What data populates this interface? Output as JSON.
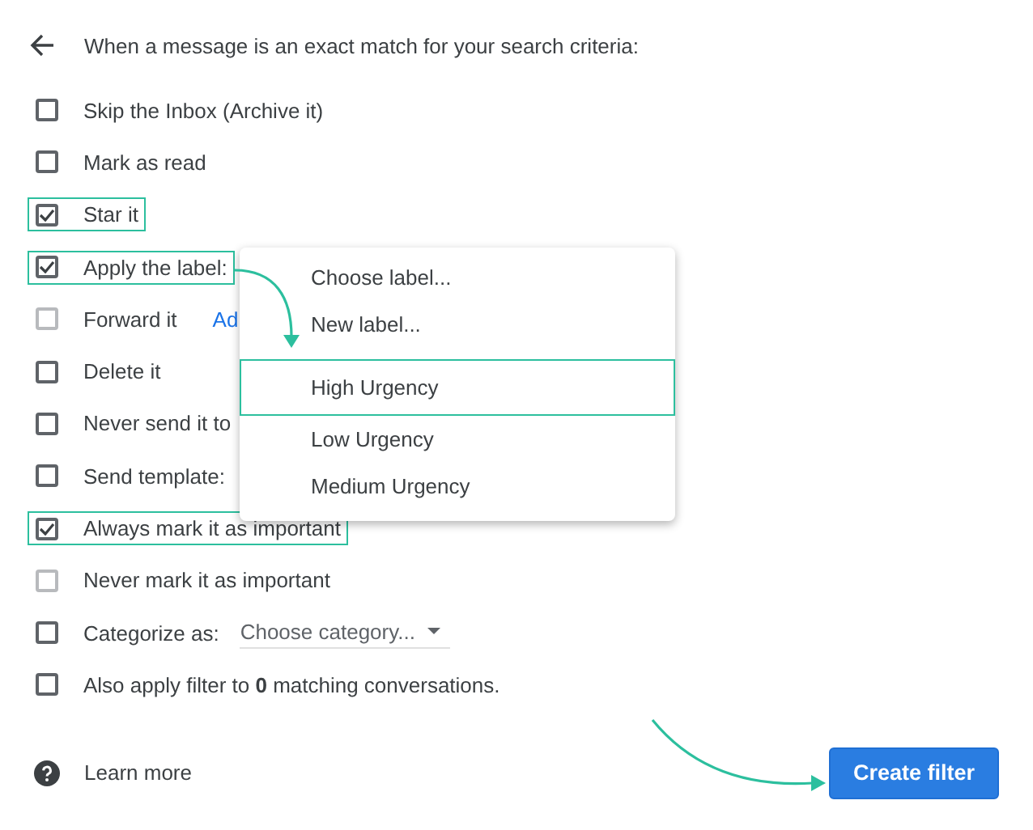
{
  "header": {
    "text": "When a message is an exact match for your search criteria:"
  },
  "actions": [
    {
      "kind": "plain",
      "label": "Skip the Inbox (Archive it)",
      "checked": false,
      "disabled": false,
      "highlighted": false
    },
    {
      "kind": "plain",
      "label": "Mark as read",
      "checked": false,
      "disabled": false,
      "highlighted": false
    },
    {
      "kind": "plain",
      "label": "Star it",
      "checked": true,
      "disabled": false,
      "highlighted": true
    },
    {
      "kind": "plain",
      "label": "Apply the label:",
      "checked": true,
      "disabled": false,
      "highlighted": true
    },
    {
      "kind": "link",
      "label": "Forward it",
      "link": "Ad",
      "checked": false,
      "disabled": true,
      "highlighted": false
    },
    {
      "kind": "plain",
      "label": "Delete it",
      "checked": false,
      "disabled": false,
      "highlighted": false
    },
    {
      "kind": "plain",
      "label": "Never send it to",
      "checked": false,
      "disabled": false,
      "highlighted": false
    },
    {
      "kind": "plain",
      "label": "Send template:",
      "checked": false,
      "disabled": false,
      "highlighted": false
    },
    {
      "kind": "plain",
      "label": "Always mark it as important",
      "checked": true,
      "disabled": false,
      "highlighted": true
    },
    {
      "kind": "plain",
      "label": "Never mark it as important",
      "checked": false,
      "disabled": true,
      "highlighted": false
    },
    {
      "kind": "dropdown",
      "label": "Categorize as:",
      "value": "Choose category...",
      "checked": false,
      "disabled": false,
      "highlighted": false
    },
    {
      "kind": "plain",
      "label": "Also apply filter to **0** matching conversations.",
      "checked": false,
      "disabled": false,
      "highlighted": false
    }
  ],
  "label_menu": {
    "commands": [
      {
        "label": "Choose label...",
        "selected": false
      },
      {
        "label": "New label...",
        "selected": false
      }
    ],
    "labels": [
      {
        "label": "High Urgency",
        "selected": true
      },
      {
        "label": "Low Urgency",
        "selected": false
      },
      {
        "label": "Medium Urgency",
        "selected": false
      }
    ]
  },
  "footer": {
    "learn_more": "Learn more",
    "button": "Create filter"
  }
}
